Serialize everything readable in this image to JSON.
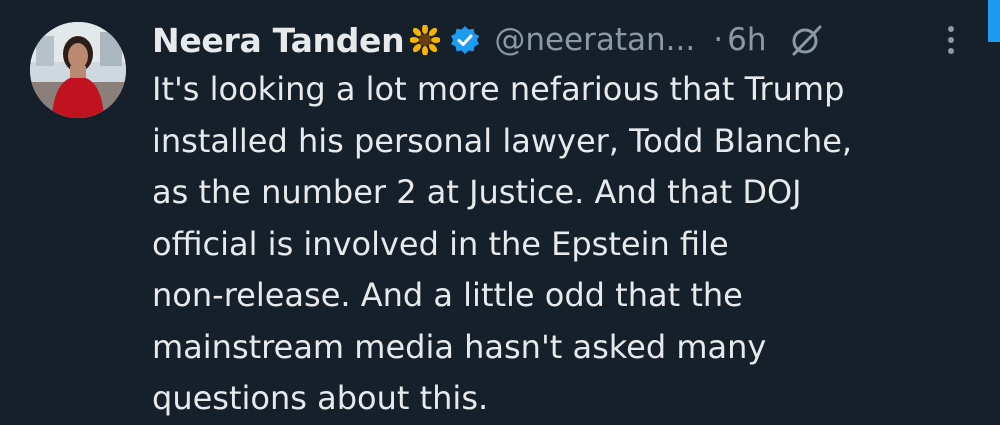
{
  "tweet": {
    "author_name": "Neera Tanden",
    "author_handle": "@neeratan...",
    "separator": "·",
    "time": "6h",
    "body_lines": [
      "It's looking a lot more nefarious that Trump",
      "installed his personal lawyer, Todd Blanche,",
      "as the number 2 at Justice.  And that DOJ",
      "official is involved in the Epstein file",
      "non-release. And a little odd that the",
      "mainstream media hasn't asked many",
      "questions about this."
    ]
  },
  "icons": {
    "avatar": "avatar-photo",
    "name_emoji": "sunflower-icon",
    "badge": "verified-badge-icon",
    "grok": "grok-icon",
    "more": "more-vertical-icon"
  },
  "colors": {
    "background": "#15202b",
    "text_primary": "#e7e9ea",
    "text_secondary": "#8b98a5",
    "accent": "#1d9bf0"
  }
}
